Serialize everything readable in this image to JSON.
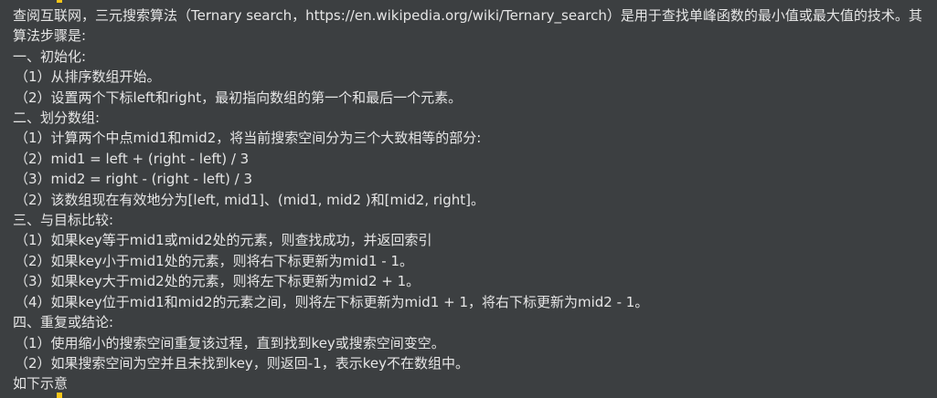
{
  "document": {
    "intro": "查阅互联网，三元搜索算法（Ternary search，https://en.wikipedia.org/wiki/Ternary_search）是用于查找单峰函数的最小值或最大值的技术。其算法步骤是:",
    "lines": [
      "一、初始化:",
      "（1）从排序数组开始。",
      "（2）设置两个下标left和right，最初指向数组的第一个和最后一个元素。",
      "二、划分数组:",
      "（1）计算两个中点mid1和mid2，将当前搜索空间分为三个大致相等的部分:",
      "（2）mid1 = left + (right - left) / 3",
      "（3）mid2 = right - (right - left) / 3",
      "（2）该数组现在有效地分为[left, mid1]、(mid1, mid2 )和[mid2, right]。",
      "三、与目标比较:",
      "（1）如果key等于mid1或mid2处的元素，则查找成功，并返回索引",
      "（2）如果key小于mid1处的元素，则将右下标更新为mid1 - 1。",
      "（3）如果key大于mid2处的元素，则将左下标更新为mid2 + 1。",
      "（4）如果key位于mid1和mid2的元素之间，则将左下标更新为mid1 + 1，将右下标更新为mid2 - 1。",
      "四、重复或结论:",
      "（1）使用缩小的搜索空间重复该过程，直到找到key或搜索空间变空。",
      "（2）如果搜索空间为空并且未找到key，则返回-1，表示key不在数组中。",
      "如下示意"
    ]
  },
  "colors": {
    "background": "#3c3f41",
    "text": "#e6e6e6",
    "accent": "#f5c518"
  }
}
